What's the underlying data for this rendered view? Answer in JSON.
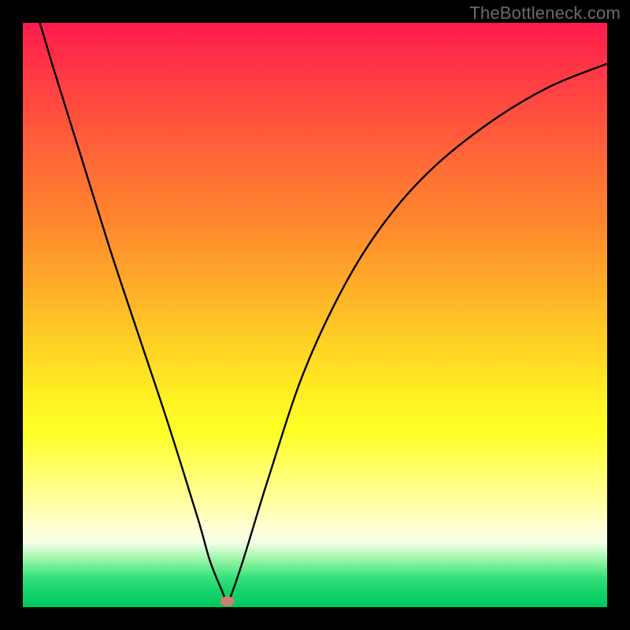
{
  "watermark": "TheBottleneck.com",
  "chart_data": {
    "type": "line",
    "title": "",
    "xlabel": "",
    "ylabel": "",
    "x_range": [
      0,
      100
    ],
    "y_range": [
      0,
      100
    ],
    "ylim": [
      0,
      100
    ],
    "series": [
      {
        "name": "bottleneck-curve",
        "x": [
          0,
          5,
          10,
          15,
          20,
          25,
          30,
          32,
          34,
          35,
          36,
          38,
          42,
          48,
          55,
          62,
          70,
          80,
          90,
          100
        ],
        "y": [
          110,
          93,
          77,
          61,
          46,
          31,
          15,
          8,
          3,
          1,
          3,
          9,
          22,
          40,
          55,
          66,
          75,
          83,
          89,
          93
        ]
      }
    ],
    "optimum_point": {
      "x": 35,
      "y": 1
    },
    "gradient_bands": [
      {
        "pos": 0.0,
        "color": "#ff1a4d",
        "meaning": "bad"
      },
      {
        "pos": 0.5,
        "color": "#ffc025",
        "meaning": "mid"
      },
      {
        "pos": 0.7,
        "color": "#ffff26",
        "meaning": "ok"
      },
      {
        "pos": 1.0,
        "color": "#00c85e",
        "meaning": "good"
      }
    ],
    "grid": false,
    "legend": false
  }
}
